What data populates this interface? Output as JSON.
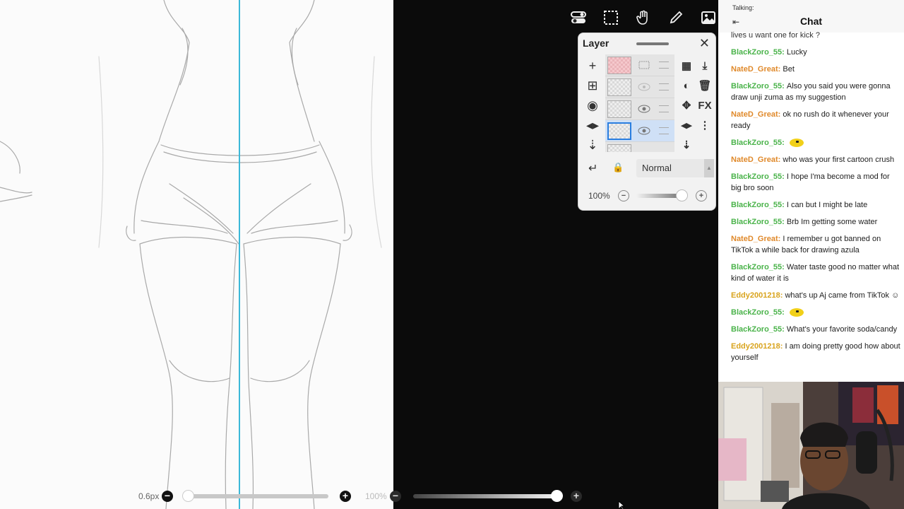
{
  "bottom_bar": {
    "brush_size": "0.6px",
    "brush_opacity": "100%"
  },
  "layer_panel": {
    "title": "Layer",
    "blend_mode": "Normal",
    "opacity": "100%"
  },
  "chat": {
    "talking_label": "Talking:",
    "title": "Chat",
    "partial_top": "lives u want one for kick ?",
    "messages": [
      {
        "user": "BlackZoro_55",
        "text": "Lucky",
        "color": "#4ab34a"
      },
      {
        "user": "NateD_Great",
        "text": "Bet",
        "color": "#e0892a"
      },
      {
        "user": "BlackZoro_55",
        "text": "Also you said you were gonna draw unji zuma as my suggestion",
        "color": "#4ab34a"
      },
      {
        "user": "NateD_Great",
        "text": "ok no rush do it whenever your ready",
        "color": "#e0892a"
      },
      {
        "user": "BlackZoro_55",
        "text": "",
        "emote": true,
        "color": "#4ab34a"
      },
      {
        "user": "NateD_Great",
        "text": "who was your first cartoon crush",
        "color": "#e0892a"
      },
      {
        "user": "BlackZoro_55",
        "text": "I hope I'ma become a mod for big bro soon",
        "color": "#4ab34a"
      },
      {
        "user": "BlackZoro_55",
        "text": "I can but I might be late",
        "color": "#4ab34a"
      },
      {
        "user": "BlackZoro_55",
        "text": "Brb Im getting some water",
        "color": "#4ab34a"
      },
      {
        "user": "NateD_Great",
        "text": "I remember u got banned on TikTok a while back for drawing azula",
        "color": "#e0892a"
      },
      {
        "user": "BlackZoro_55",
        "text": "Water taste good no matter what kind of water it is",
        "color": "#4ab34a"
      },
      {
        "user": "Eddy2001218",
        "text": "what's up Aj came from TikTok ☺",
        "color": "#d9a41e"
      },
      {
        "user": "BlackZoro_55",
        "text": "",
        "emote": true,
        "color": "#4ab34a"
      },
      {
        "user": "BlackZoro_55",
        "text": "What's your favorite soda/candy",
        "color": "#4ab34a"
      },
      {
        "user": "Eddy2001218",
        "text": "I am doing pretty good how about yourself",
        "color": "#d9a41e"
      }
    ]
  }
}
